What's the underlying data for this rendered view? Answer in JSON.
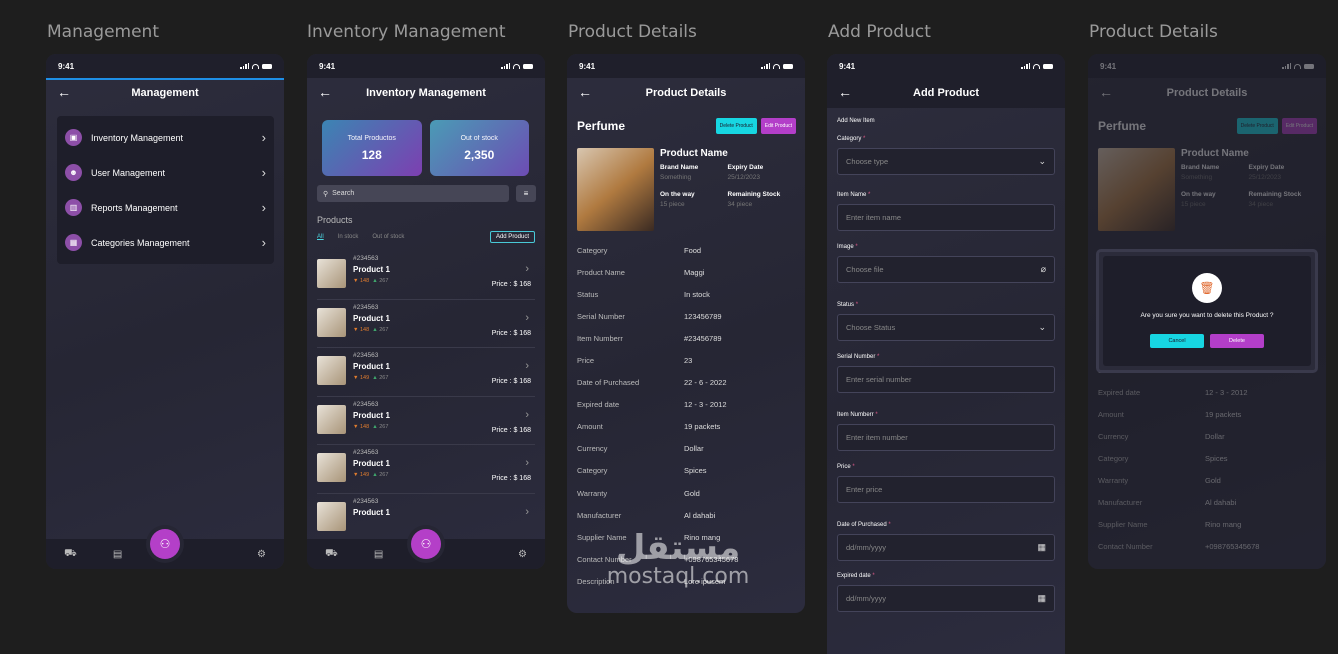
{
  "frames": {
    "management": "Management",
    "inventory": "Inventory Management",
    "details": "Product Details",
    "add": "Add Product",
    "details2": "Product Details"
  },
  "status_time": "9:41",
  "management": {
    "title": "Management",
    "items": [
      {
        "label": "Inventory Management",
        "icon": "box-icon"
      },
      {
        "label": "User Management",
        "icon": "users-icon"
      },
      {
        "label": "Reports Management",
        "icon": "chart-icon"
      },
      {
        "label": "Categories Management",
        "icon": "grid-icon"
      }
    ]
  },
  "inventory": {
    "title": "Inventory Management",
    "total_label": "Total Productos",
    "total_value": "128",
    "oos_label": "Out of stock",
    "oos_value": "2,350",
    "search_placeholder": "Search",
    "products_header": "Products",
    "filters": [
      "All",
      "In stock",
      "Out of stock"
    ],
    "add_button": "Add Product",
    "products": [
      {
        "id": "#234563",
        "name": "Product 1",
        "up": "148",
        "down": "267",
        "price": "Price : $ 168"
      },
      {
        "id": "#234563",
        "name": "Product 1",
        "up": "148",
        "down": "267",
        "price": "Price : $ 168"
      },
      {
        "id": "#234563",
        "name": "Product 1",
        "up": "149",
        "down": "267",
        "price": "Price : $ 168"
      },
      {
        "id": "#234563",
        "name": "Product 1",
        "up": "148",
        "down": "267",
        "price": "Price : $ 168"
      },
      {
        "id": "#234563",
        "name": "Product 1",
        "up": "149",
        "down": "267",
        "price": "Price : $ 168"
      },
      {
        "id": "#234563",
        "name": "Product 1",
        "up": "",
        "down": "",
        "price": ""
      }
    ]
  },
  "details": {
    "title": "Product Details",
    "product_title": "Perfume",
    "delete_btn": "Delete Product",
    "edit_btn": "Edit Product",
    "product_name_heading": "Product Name",
    "brand_k": "Brand Name",
    "brand_v": "Something",
    "expiry_k": "Expiry Date",
    "expiry_v": "25/12/2023",
    "way_k": "On the way",
    "way_v": "15 piece",
    "remain_k": "Remaining Stock",
    "remain_v": "34 piece",
    "rows": [
      {
        "k": "Category",
        "v": "Food"
      },
      {
        "k": "Product Name",
        "v": "Maggi"
      },
      {
        "k": "Status",
        "v": "In stock"
      },
      {
        "k": "Serial Number",
        "v": "123456789"
      },
      {
        "k": "Item Numberr",
        "v": "#23456789"
      },
      {
        "k": "Price",
        "v": "23"
      },
      {
        "k": "Date of Purchased",
        "v": "22 - 6 - 2022"
      },
      {
        "k": "Expired date",
        "v": "12 - 3 - 2012"
      },
      {
        "k": "Amount",
        "v": "19 packets"
      },
      {
        "k": "Currency",
        "v": "Dollar"
      },
      {
        "k": "Category",
        "v": "Spices"
      },
      {
        "k": "Warranty",
        "v": "Gold"
      },
      {
        "k": "Manufacturer",
        "v": "Al dahabi"
      },
      {
        "k": "Supplier Name",
        "v": "Rino mang"
      },
      {
        "k": "Contact Number",
        "v": "+098765345678"
      },
      {
        "k": "Description",
        "v": "Lore ipusem"
      }
    ]
  },
  "add": {
    "title": "Add Product",
    "sub": "Add New Item",
    "fields": [
      {
        "label": "Category",
        "placeholder": "Choose type",
        "icon": "chevron-down-icon"
      },
      {
        "label": "Item Name",
        "placeholder": "Enter item name",
        "icon": ""
      },
      {
        "label": "Image",
        "placeholder": "Choose file",
        "icon": "paperclip-icon"
      },
      {
        "label": "Status",
        "placeholder": "Choose Status",
        "icon": "chevron-down-icon"
      },
      {
        "label": "Serial Number",
        "placeholder": "Enter serial number",
        "icon": ""
      },
      {
        "label": "Item Numberr",
        "placeholder": "Enter item number",
        "icon": ""
      },
      {
        "label": "Price",
        "placeholder": "Enter price",
        "icon": ""
      },
      {
        "label": "Date of Purchased",
        "placeholder": "dd/mm/yyyy",
        "icon": "calendar-icon"
      },
      {
        "label": "Expired date",
        "placeholder": "dd/mm/yyyy",
        "icon": "calendar-icon"
      }
    ]
  },
  "dialog": {
    "question": "Are you sure you want to delete this Product ?",
    "cancel": "Cancel",
    "delete": "Delete"
  },
  "watermark": {
    "ar": "مستقل",
    "en": "mostaql.com"
  }
}
